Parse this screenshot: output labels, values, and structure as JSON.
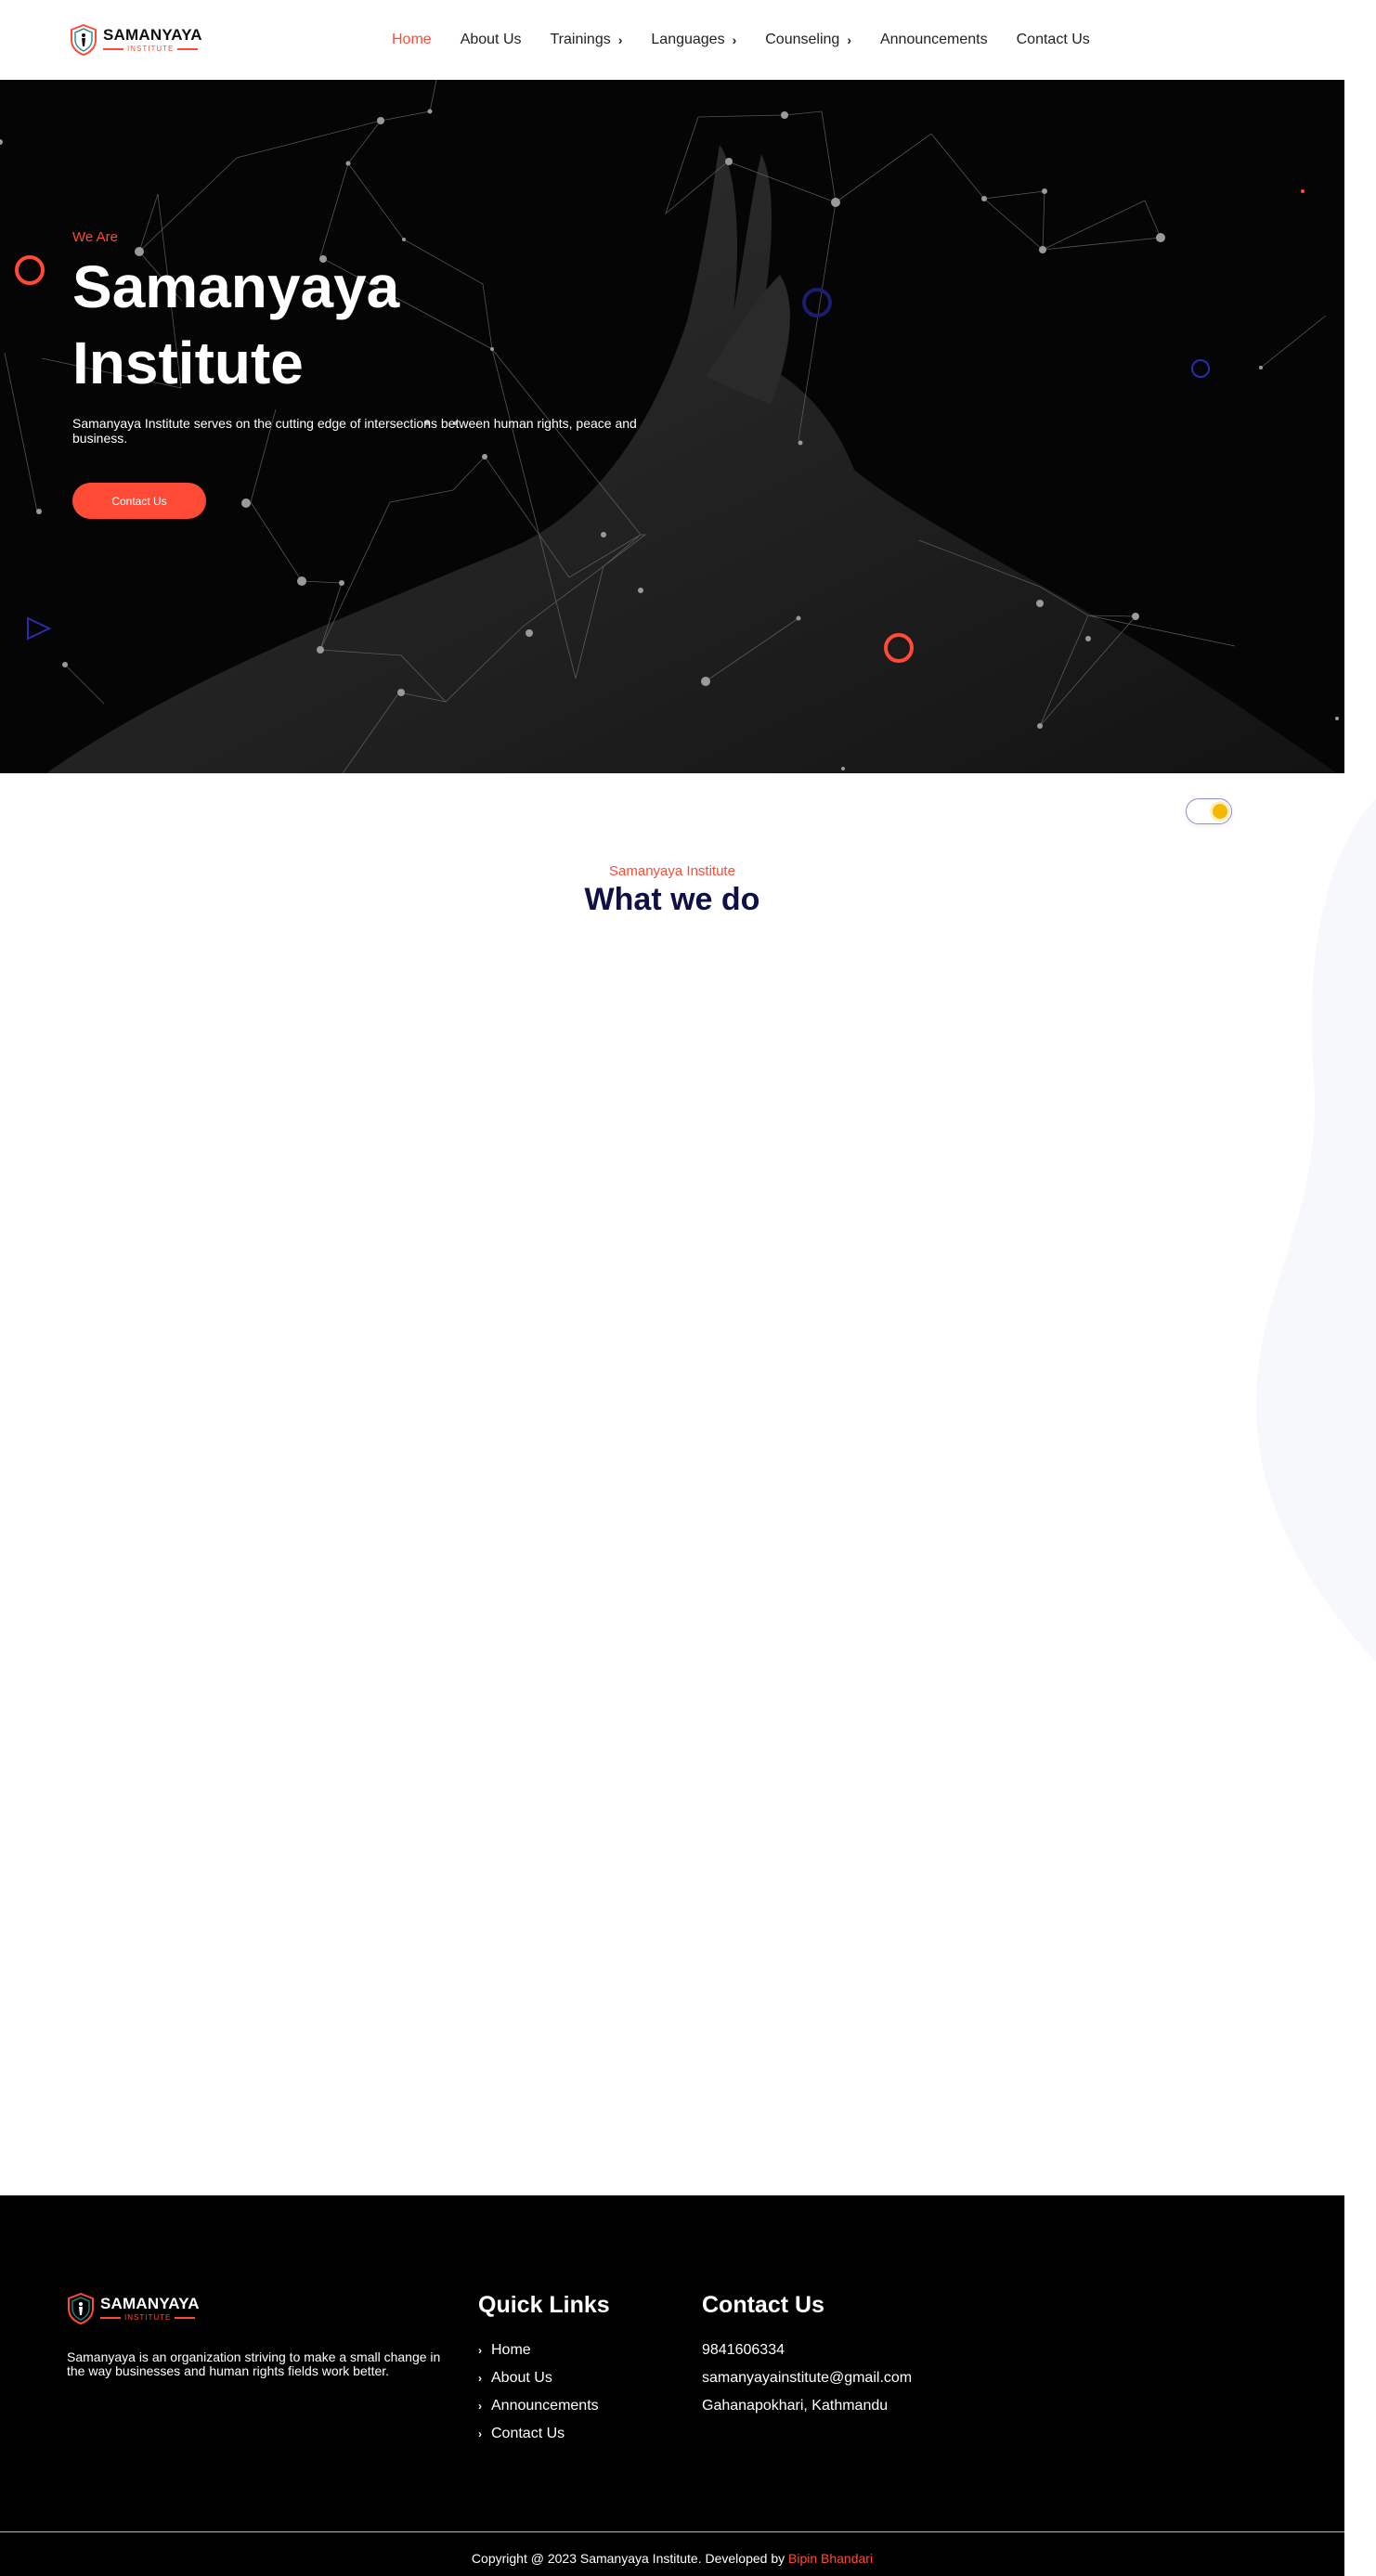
{
  "header": {
    "logo": {
      "title": "SAMANYAYA",
      "subtitle": "INSTITUTE"
    },
    "nav": [
      {
        "label": "Home",
        "active": true,
        "dropdown": false
      },
      {
        "label": "About Us",
        "active": false,
        "dropdown": false
      },
      {
        "label": "Trainings",
        "active": false,
        "dropdown": true
      },
      {
        "label": "Languages",
        "active": false,
        "dropdown": true
      },
      {
        "label": "Counseling",
        "active": false,
        "dropdown": true
      },
      {
        "label": "Announcements",
        "active": false,
        "dropdown": false
      },
      {
        "label": "Contact Us",
        "active": false,
        "dropdown": false
      }
    ]
  },
  "hero": {
    "eyebrow": "We Are",
    "title": "Samanyaya Institute",
    "description": "Samanyaya Institute serves on the cutting edge of intersections between human rights, peace and business.",
    "button": "Contact Us"
  },
  "section": {
    "eyebrow": "Samanyaya Institute",
    "title": "What we do"
  },
  "footer": {
    "logo": {
      "title": "SAMANYAYA",
      "subtitle": "INSTITUTE"
    },
    "about": "Samanyaya is an organization striving to make a small change in the way businesses and human rights fields work better.",
    "quick_links_title": "Quick Links",
    "quick_links": [
      "Home",
      "About Us",
      "Announcements",
      "Contact Us"
    ],
    "contact_title": "Contact Us",
    "contact": {
      "phone": "9841606334",
      "email": "samanyayainstitute@gmail.com",
      "address": "Gahanapokhari, Kathmandu"
    },
    "copyright": "Copyright @ 2023 Samanyaya Institute. Developed by",
    "developer": "Bipin Bhandari"
  },
  "colors": {
    "accent": "#ff4b36",
    "navy": "#0f1046",
    "hero_bg": "#050505",
    "footer_bg": "#000000",
    "toggle_knob": "#f5b800"
  },
  "icons": {
    "logo": "shield-logo-icon",
    "nav_dropdown": "chevron-right-icon",
    "footer_link": "chevron-right-icon",
    "theme_toggle": "sun-icon"
  }
}
